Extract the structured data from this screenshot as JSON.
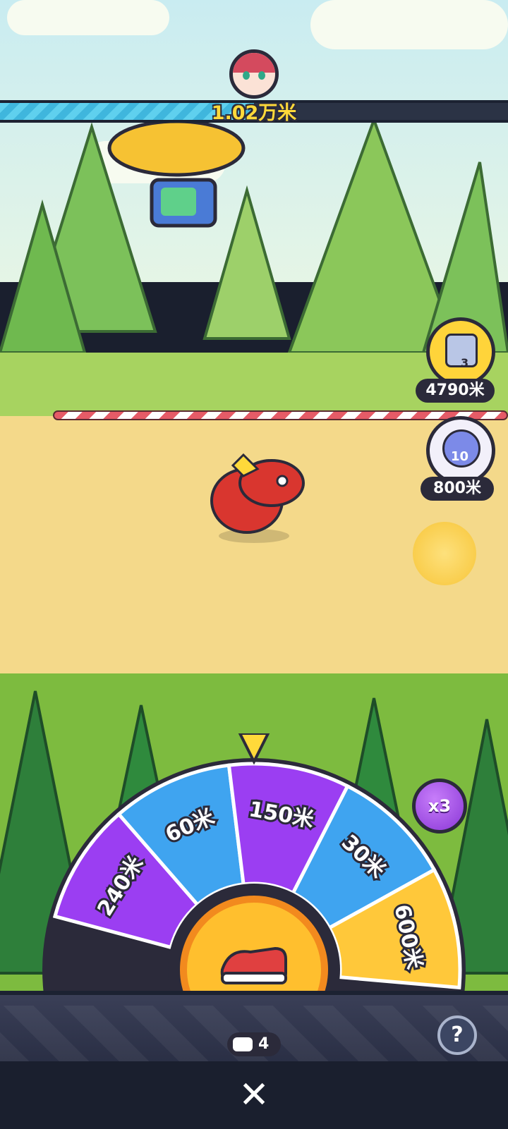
{
  "header": {
    "distance_label": "1.02万米",
    "progress_fraction": 0.5
  },
  "rewards": [
    {
      "icon": "mystery-box-icon",
      "badge": "3",
      "label": "4790米"
    },
    {
      "icon": "cat-capsule-icon",
      "badge": "10",
      "label": "800米"
    }
  ],
  "wheel": {
    "segments": [
      {
        "label": "240米",
        "color": "#9b3ef2"
      },
      {
        "label": "60米",
        "color": "#3fa4f0"
      },
      {
        "label": "150米",
        "color": "#9b3ef2"
      },
      {
        "label": "30米",
        "color": "#3fa4f0"
      },
      {
        "label": "600米",
        "color": "#ffc83a"
      }
    ],
    "multiplier": "x3",
    "spin_icon": "sneaker-icon",
    "shoe_count": "4"
  },
  "controls": {
    "help_label": "?",
    "close_label": "✕"
  },
  "colors": {
    "accent_yellow": "#ffd93a",
    "dark_outline": "#2b2a3a",
    "progress_blue": "#5fd0ee"
  }
}
